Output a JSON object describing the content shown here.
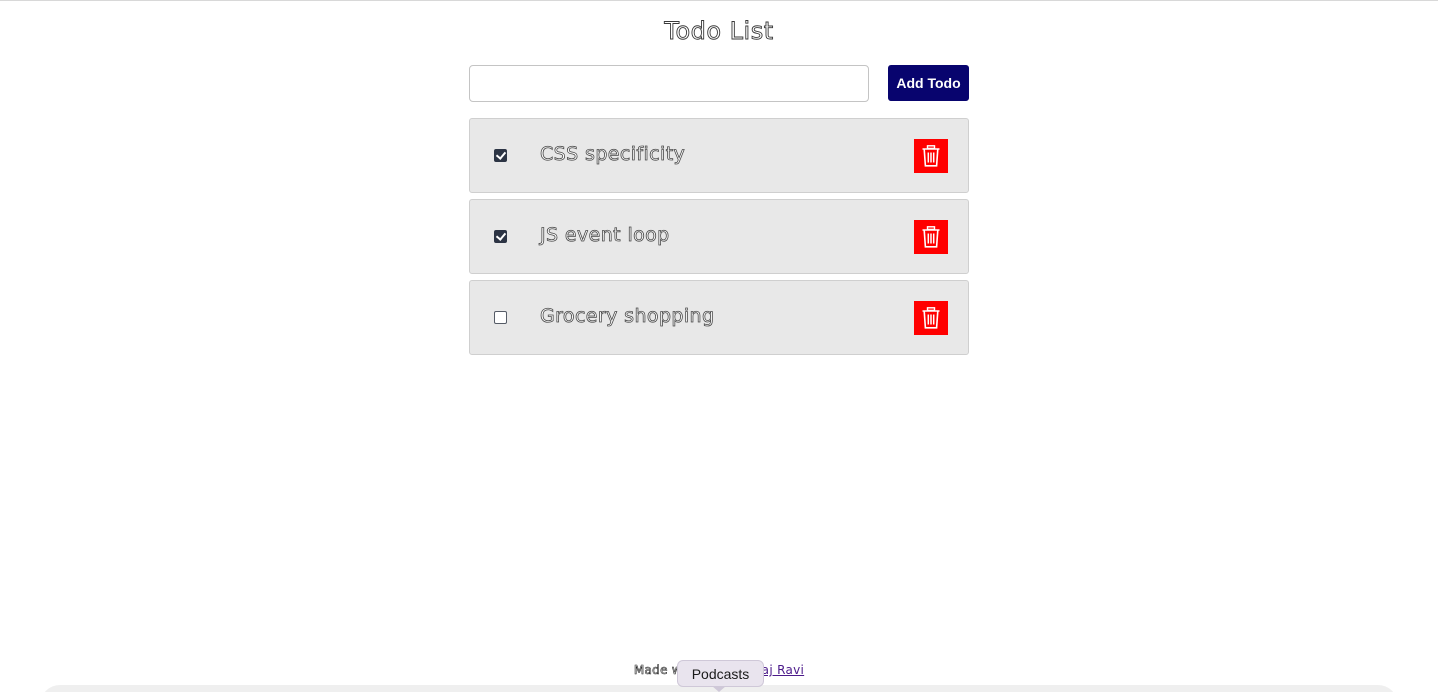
{
  "app": {
    "title": "Todo List"
  },
  "form": {
    "input_value": "",
    "input_placeholder": "",
    "add_label": "Add Todo"
  },
  "todos": [
    {
      "text": "CSS specificity",
      "done": true
    },
    {
      "text": "JS event loop",
      "done": true
    },
    {
      "text": "Grocery shopping",
      "done": false
    }
  ],
  "footer": {
    "prefix": "Made with",
    "link_text": "Bharadwaj Ravi"
  },
  "dock": {
    "tooltip": "Podcasts"
  },
  "colors": {
    "add_button": "#08046e",
    "delete_button": "#ff0000",
    "item_background": "#e8e8e8",
    "footer_link": "#4b1a8a"
  },
  "icons": {
    "delete": "trash-icon"
  }
}
